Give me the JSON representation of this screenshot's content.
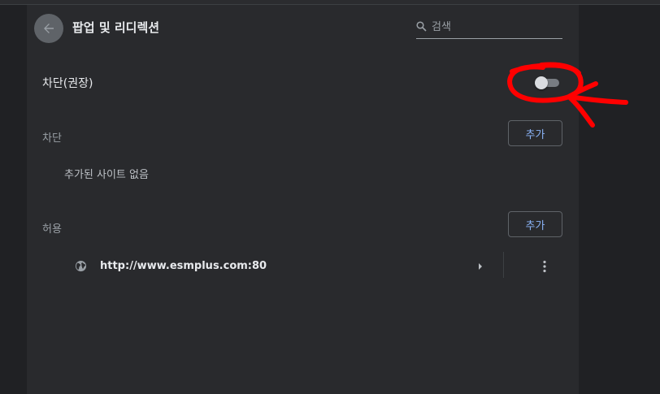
{
  "header": {
    "title": "팝업 및 리디렉션",
    "search_placeholder": "검색"
  },
  "blocked_recommended": {
    "label": "차단(권장)",
    "toggle_on": false
  },
  "block_section": {
    "label": "차단",
    "add_label": "추가",
    "empty_text": "추가된 사이트 없음"
  },
  "allow_section": {
    "label": "허용",
    "add_label": "추가",
    "sites": [
      {
        "url": "http://www.esmplus.com:80"
      }
    ]
  },
  "colors": {
    "background": "#202124",
    "card": "#292a2d",
    "accent_text": "#8ab4f8",
    "annotation": "#ff0000"
  },
  "icons": [
    "back-arrow-icon",
    "search-icon",
    "globe-icon",
    "chevron-right-icon",
    "more-vert-icon"
  ]
}
